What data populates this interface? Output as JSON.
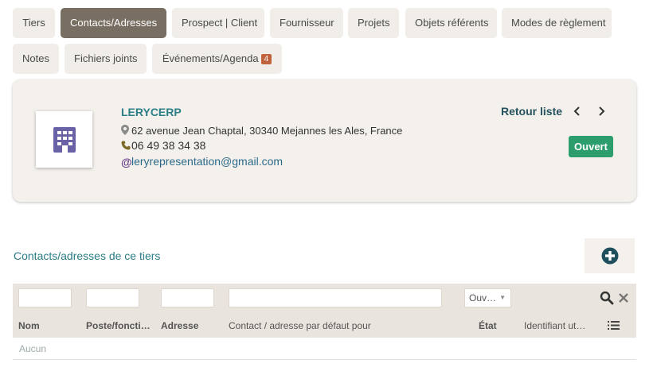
{
  "tabs": [
    {
      "label": "Tiers",
      "active": false
    },
    {
      "label": "Contacts/Adresses",
      "active": true
    },
    {
      "label": "Prospect | Client",
      "active": false
    },
    {
      "label": "Fournisseur",
      "active": false
    },
    {
      "label": "Projets",
      "active": false
    },
    {
      "label": "Objets référents",
      "active": false
    },
    {
      "label": "Modes de règlement",
      "active": false
    },
    {
      "label": "Notes",
      "active": false
    },
    {
      "label": "Fichiers joints",
      "active": false
    },
    {
      "label": "Événements/Agenda",
      "active": false,
      "badge": "4"
    }
  ],
  "company": {
    "name": "LERYCERP",
    "address": "62 avenue Jean Chaptal, 30340 Mejannes les Ales, France",
    "phone": "06 49 38 34 38",
    "email": "leryrepresentation@gmail.com",
    "status": "Ouvert",
    "back_label": "Retour liste",
    "icons": {
      "address": "map-marker-icon",
      "phone": "phone-icon",
      "email": "at-sign-icon",
      "logo": "building-icon"
    }
  },
  "colors": {
    "accent": "#2b7d86",
    "active_tab": "#786e62",
    "status_green": "#2c9e6e",
    "badge": "#c0623c",
    "card_bg": "#f4f1ed"
  },
  "contacts_section": {
    "title": "Contacts/adresses de ce tiers",
    "add_icon": "plus-circle-icon"
  },
  "table": {
    "filter_status_value": "Ouv…",
    "columns": [
      "Nom",
      "Poste/foncti…",
      "Adresse",
      "Contact / adresse par défaut pour",
      "État",
      "Identifiant ut…"
    ],
    "empty_text": "Aucun"
  }
}
